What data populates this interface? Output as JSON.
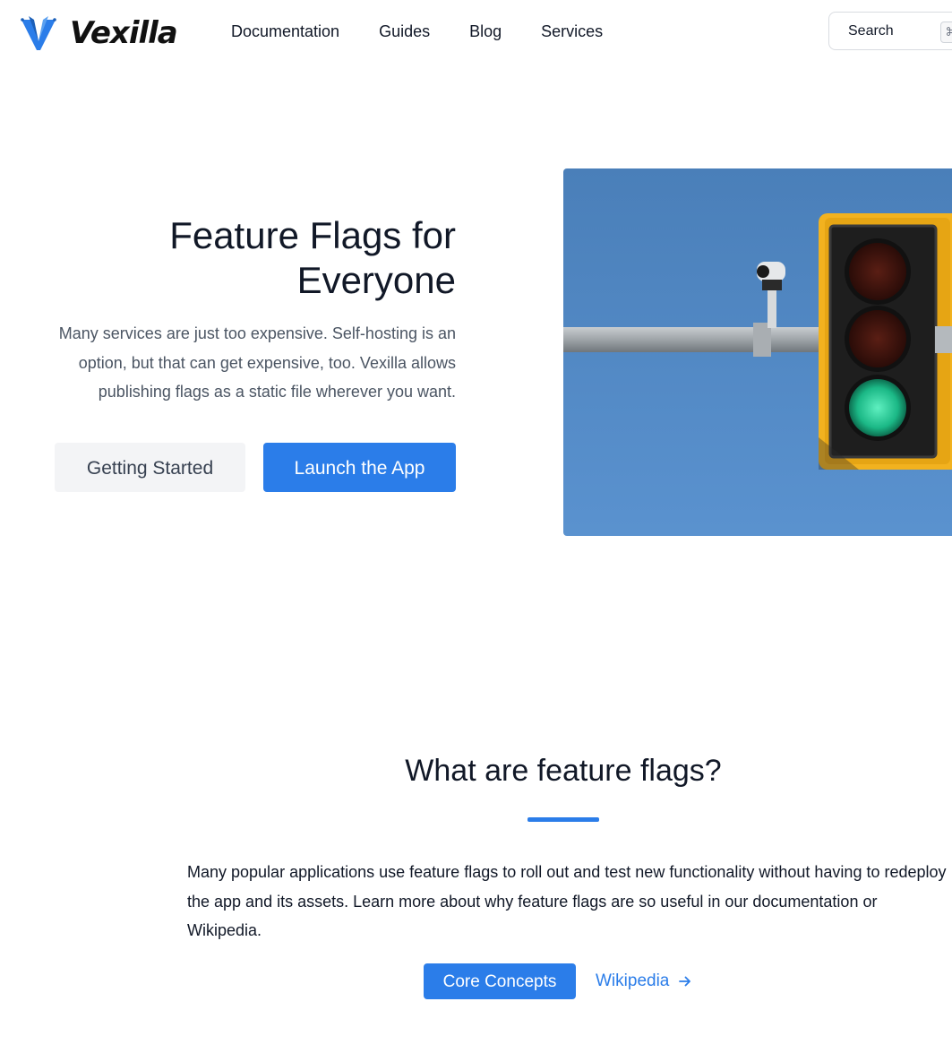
{
  "header": {
    "logo_text": "Vexilla",
    "nav": [
      "Documentation",
      "Guides",
      "Blog",
      "Services"
    ],
    "search": {
      "label": "Search",
      "shortcut": "⌘"
    }
  },
  "hero": {
    "title_line1": "Feature Flags for",
    "title_line2": "Everyone",
    "description": "Many services are just too expensive. Self-hosting is an option, but that can get expensive, too. Vexilla allows publishing flags as a static file wherever you want.",
    "primary_button": "Launch the App",
    "secondary_button": "Getting Started"
  },
  "section": {
    "title": "What are feature flags?",
    "text": "Many popular applications use feature flags to roll out and test new functionality without having to redeploy the app and its assets. Learn more about why feature flags are so useful in our documentation or Wikipedia.",
    "core_button": "Core Concepts",
    "wiki_link": "Wikipedia"
  },
  "colors": {
    "accent": "#2b7de9",
    "text": "#111827",
    "muted": "#4b5563",
    "button_gray": "#f3f4f6",
    "sky": "#4b86c4"
  },
  "icons": {
    "logo": "vexilla-v-logo-icon",
    "search_shortcut": "command-key-icon",
    "wiki_arrow": "arrow-right-icon"
  }
}
